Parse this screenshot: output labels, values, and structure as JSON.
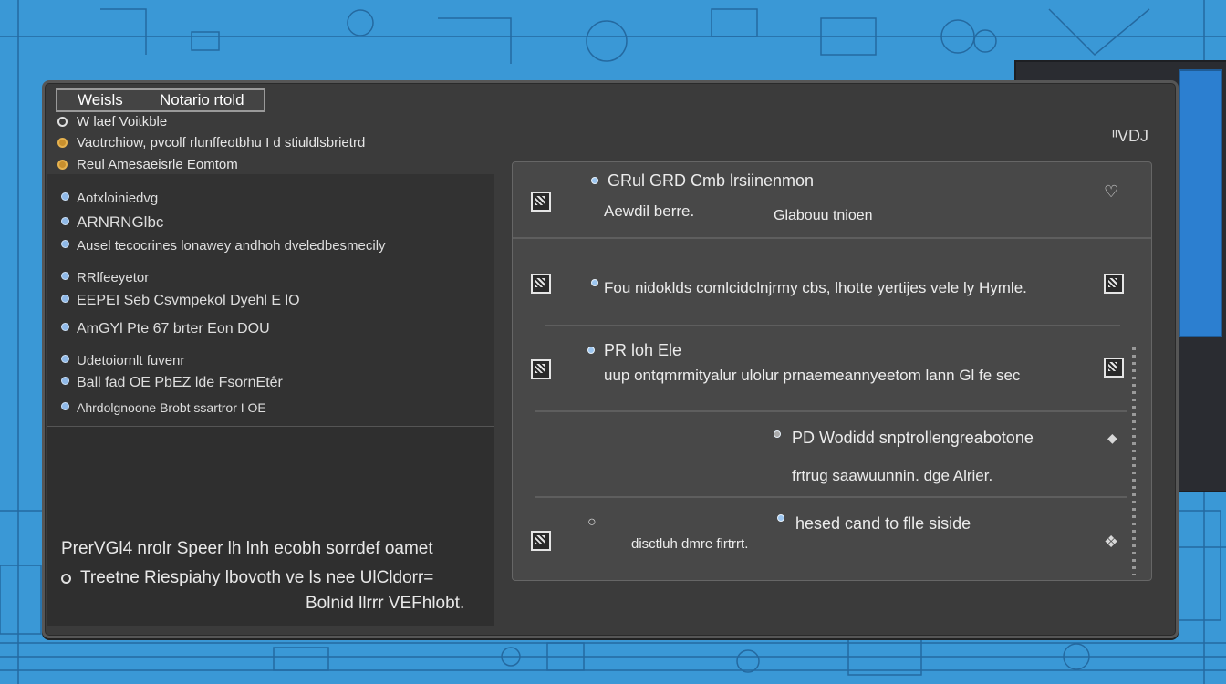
{
  "window": {
    "title_left": "Weisls",
    "title_right": "Notario rtold",
    "top_right_label": "ᴵᴵVDJ"
  },
  "header_items": [
    {
      "text": "W laef Voitkble",
      "icon": "radio-ring-icon"
    },
    {
      "text": "Vaotrchiow, pvcolf rlunffeotbhu I d stiuldlsbrietrd",
      "icon": "amber-dot-icon"
    },
    {
      "text": "Reul Amesaeisrle Eomtom",
      "icon": "amber-dot-icon"
    }
  ],
  "left_list": [
    "Aotxloiniedvg",
    "ARNRNGlbc",
    "Ausel tecocrines lonawey andhoh dveledbesmecily",
    "RRlfeeyetor",
    "EEPEI Seb Csvmpekol Dyehl E lO",
    "AmGYl Pte 67 brter Eon DOU",
    "Udetoiornlt fuvenr",
    "Ball fad OE PbEZ lde FsornEtêr",
    "Ahrdolgnoone Brobt ssartror I OE"
  ],
  "left_lower": {
    "line1": "PrerVGl4 nrolr Speer lh lnh ecobh sorrdef oamet",
    "line2": "Treetne Riespiahy lbovoth ve ls nee UlCldorr=",
    "line3": "Bolnid llrrr VEFhlobt."
  },
  "right_rows": [
    {
      "title": "GRul GRD Cmb lrsiinenmon",
      "sub1": "Aewdil berre.",
      "sub2": "Glabouu tnioen",
      "right_icon": "chevron-down-icon"
    },
    {
      "title": "Fou nidoklds comlcidclnjrmy cbs, lhotte yertijes vele ly Hymle.",
      "right_icon": "image-icon"
    },
    {
      "title": "PR loh Ele",
      "sub1": "uup ontqmrmityalur ulolur prnaemeannyeetom lann Gl fe sec",
      "right_icon": "image-icon"
    },
    {
      "title": "PD Wodidd snptrollengreabotone",
      "sub1": "frtrug saawuunnin. dge Alrier.",
      "right_icon": "diamond-icon"
    },
    {
      "title": "hesed cand to flle siside",
      "sub1": "disctluh dmre firtrrt.",
      "right_icon": "pin-icon"
    }
  ]
}
